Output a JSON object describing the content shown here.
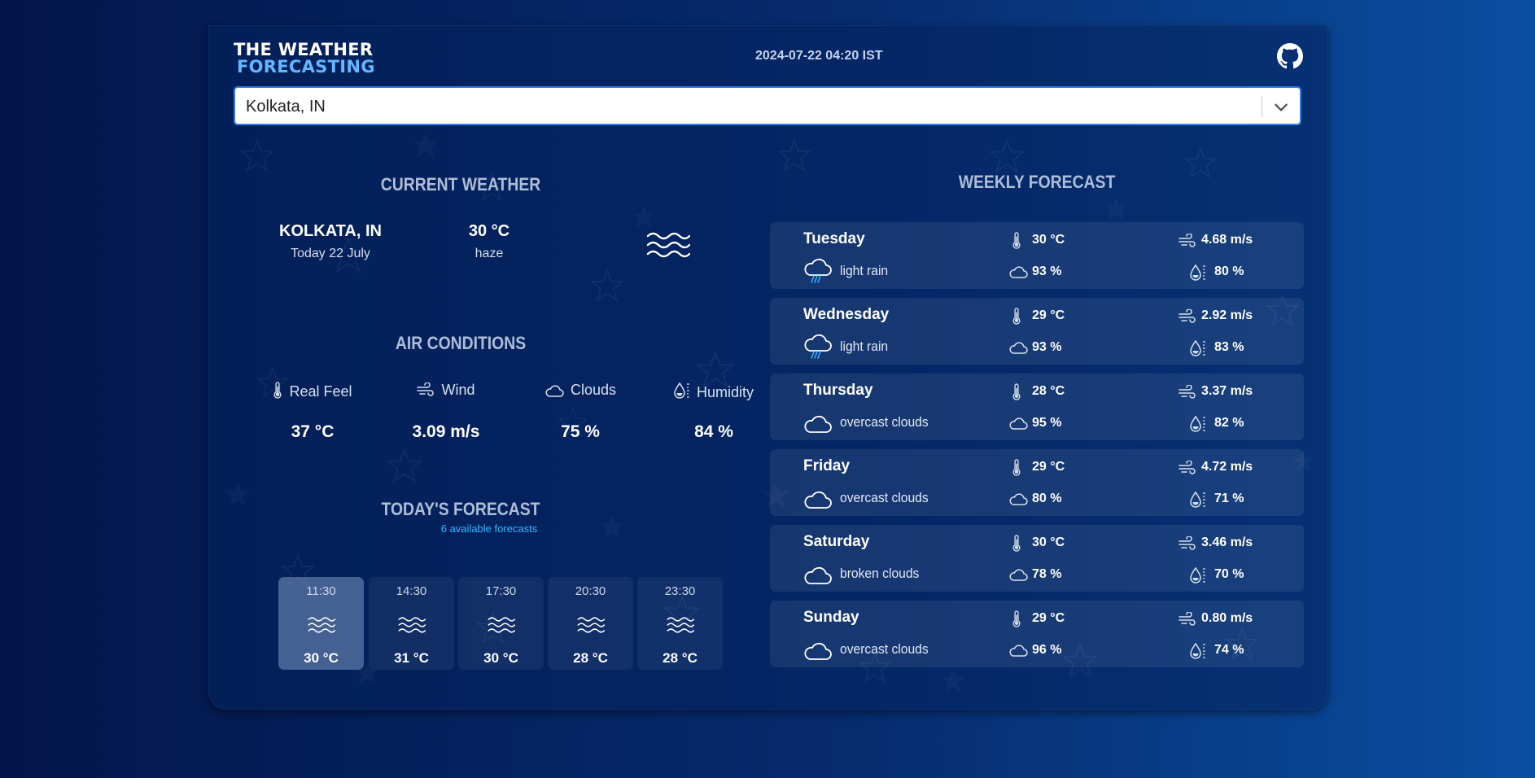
{
  "header": {
    "logo_line1": "THE WEATHER",
    "logo_line2": "FORECASTING",
    "datetime": "2024-07-22 04:20 IST"
  },
  "search": {
    "value": "Kolkata, IN"
  },
  "current_weather": {
    "title": "CURRENT WEATHER",
    "city": "KOLKATA, IN",
    "date": "Today 22 July",
    "temperature": "30 °C",
    "description": "haze",
    "icon": "haze-icon"
  },
  "air_conditions": {
    "title": "AIR CONDITIONS",
    "items": [
      {
        "label": "Real Feel",
        "value": "37 °C",
        "icon": "thermometer-icon"
      },
      {
        "label": "Wind",
        "value": "3.09 m/s",
        "icon": "wind-icon"
      },
      {
        "label": "Clouds",
        "value": "75 %",
        "icon": "cloud-icon"
      },
      {
        "label": "Humidity",
        "value": "84 %",
        "icon": "humidity-icon"
      }
    ]
  },
  "todays_forecast": {
    "title": "TODAY'S FORECAST",
    "subtitle": "6 available forecasts",
    "items": [
      {
        "time": "11:30",
        "temp": "30 °C",
        "icon": "haze-icon"
      },
      {
        "time": "14:30",
        "temp": "31 °C",
        "icon": "haze-icon"
      },
      {
        "time": "17:30",
        "temp": "30 °C",
        "icon": "haze-icon"
      },
      {
        "time": "20:30",
        "temp": "28 °C",
        "icon": "haze-icon"
      },
      {
        "time": "23:30",
        "temp": "28 °C",
        "icon": "haze-icon"
      }
    ]
  },
  "weekly_forecast": {
    "title": "WEEKLY FORECAST",
    "days": [
      {
        "day": "Tuesday",
        "desc": "light rain",
        "temp": "30 °C",
        "wind": "4.68 m/s",
        "clouds": "93 %",
        "humidity": "80 %",
        "icon": "rain-icon"
      },
      {
        "day": "Wednesday",
        "desc": "light rain",
        "temp": "29 °C",
        "wind": "2.92 m/s",
        "clouds": "93 %",
        "humidity": "83 %",
        "icon": "rain-icon"
      },
      {
        "day": "Thursday",
        "desc": "overcast clouds",
        "temp": "28 °C",
        "wind": "3.37 m/s",
        "clouds": "95 %",
        "humidity": "82 %",
        "icon": "cloud-icon"
      },
      {
        "day": "Friday",
        "desc": "overcast clouds",
        "temp": "29 °C",
        "wind": "4.72 m/s",
        "clouds": "80 %",
        "humidity": "71 %",
        "icon": "cloud-icon"
      },
      {
        "day": "Saturday",
        "desc": "broken clouds",
        "temp": "30 °C",
        "wind": "3.46 m/s",
        "clouds": "78 %",
        "humidity": "70 %",
        "icon": "cloud-icon"
      },
      {
        "day": "Sunday",
        "desc": "overcast clouds",
        "temp": "29 °C",
        "wind": "0.80 m/s",
        "clouds": "96 %",
        "humidity": "74 %",
        "icon": "cloud-icon"
      }
    ]
  },
  "colors": {
    "accent": "#2fb9ff",
    "logo_accent": "#63b6ff",
    "search_border": "#2f7fe6"
  }
}
